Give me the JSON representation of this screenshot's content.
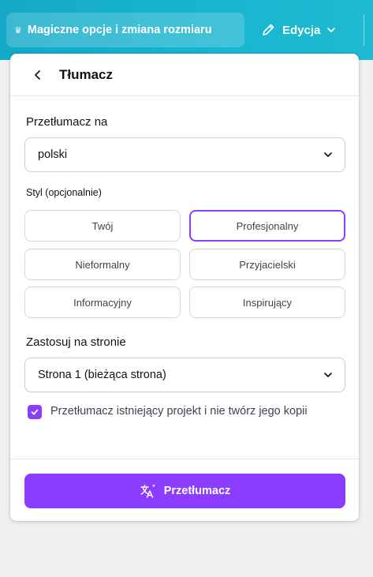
{
  "toolbar": {
    "magic_label": "Magiczne opcje i zmiana rozmiaru",
    "magic_icon": "crown-icon",
    "edit_label": "Edycja",
    "edit_icon": "pencil-icon"
  },
  "panel": {
    "title": "Tłumacz",
    "translate_to_label": "Przetłumacz na",
    "language_value": "polski",
    "style_label": "Styl (opcjonalnie)",
    "styles": [
      "Twój",
      "Profesjonalny",
      "Nieformalny",
      "Przyjacielski",
      "Informacyjny",
      "Inspirujący"
    ],
    "selected_style": "Profesjonalny",
    "apply_label": "Zastosuj na stronie",
    "page_value": "Strona 1 (bieżąca strona)",
    "checkbox_checked": true,
    "checkbox_label": "Przetłumacz istniejący projekt i nie twórz jego kopii",
    "translate_button": "Przetłumacz",
    "accent": "#8b3dff"
  }
}
